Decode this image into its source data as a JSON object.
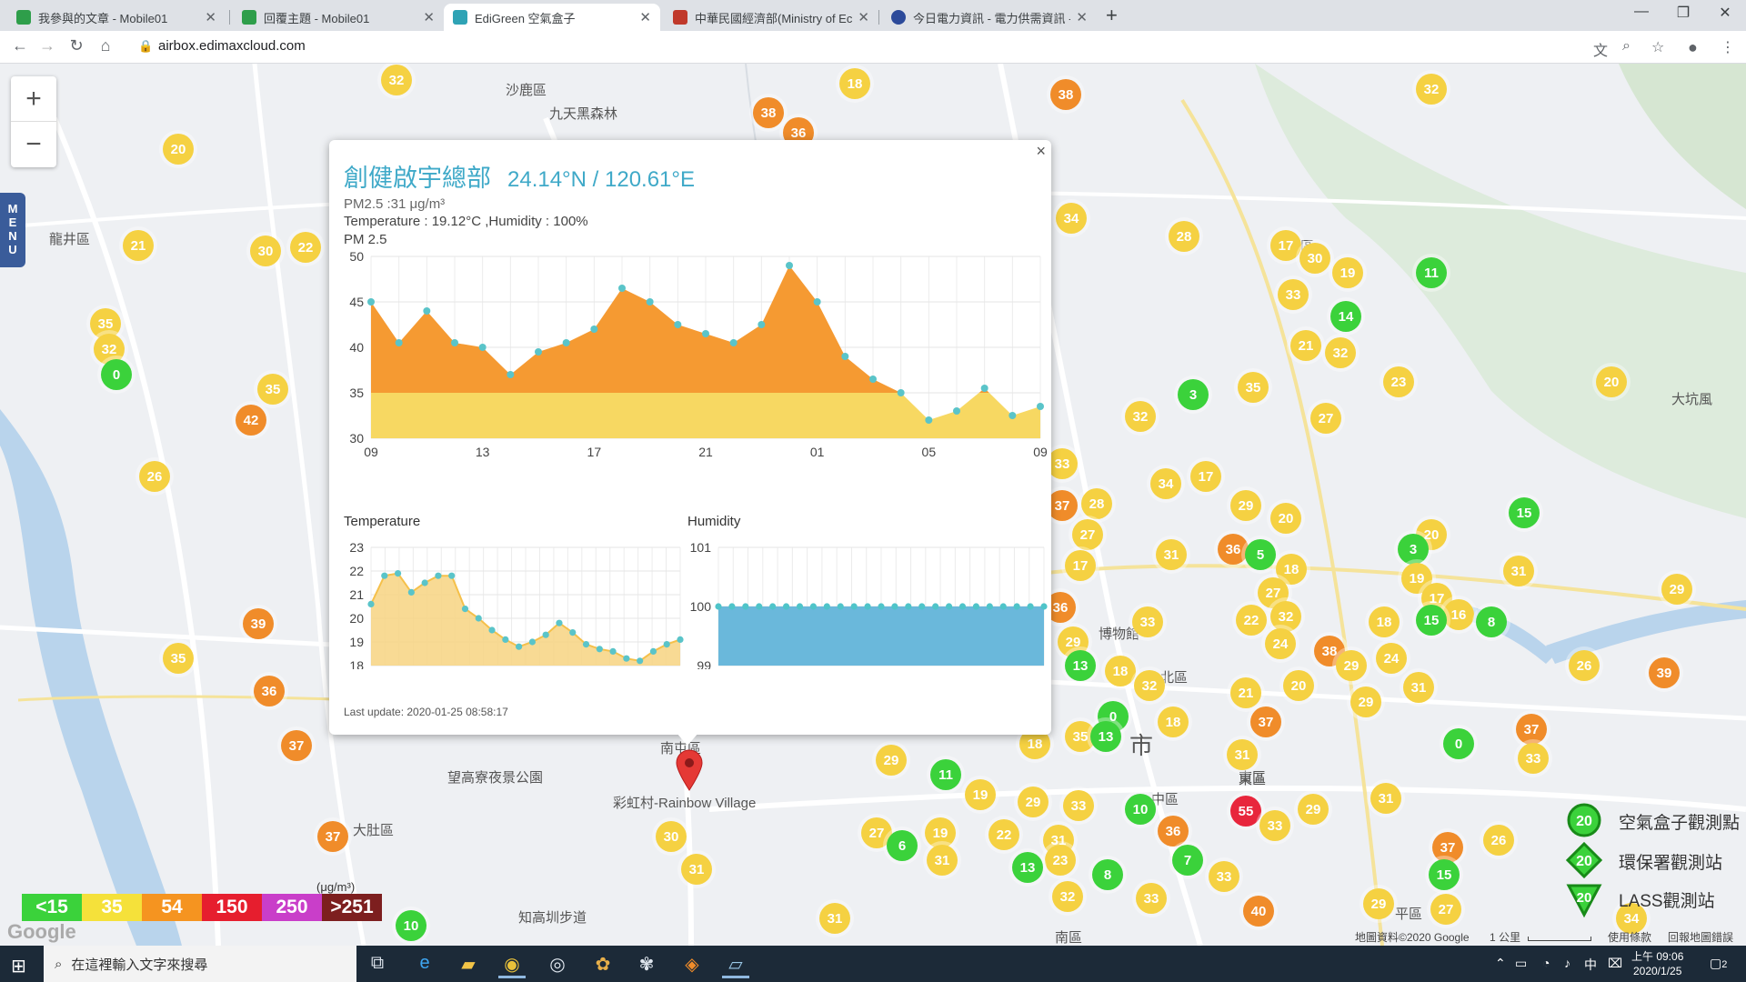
{
  "browser": {
    "tabs": [
      {
        "title": "我參與的文章 - Mobile01",
        "favicon_color": "#2e9e4a",
        "active": false
      },
      {
        "title": "回覆主題 - Mobile01",
        "favicon_color": "#2e9e4a",
        "active": false
      },
      {
        "title": "EdiGreen 空氣盒子",
        "favicon_color": "#2fa3b5",
        "active": true
      },
      {
        "title": "中華民國經濟部(Ministry of Eco",
        "favicon_color": "#c0392b",
        "active": false
      },
      {
        "title": "今日電力資訊 - 電力供需資訊 - 決",
        "favicon_color": "#2c4a9a",
        "active": false
      }
    ],
    "url": "airbox.edimaxcloud.com"
  },
  "map": {
    "labels": [
      {
        "text": "沙鹿區"
      },
      {
        "text": "九天黑森林"
      },
      {
        "text": "龍井區"
      },
      {
        "text": "潭子區"
      },
      {
        "text": "大坑風"
      },
      {
        "text": "望高寮夜景公園"
      },
      {
        "text": "彩虹村-Rainbow Village"
      },
      {
        "text": "大肚區"
      },
      {
        "text": "知高圳步道"
      },
      {
        "text": "北區"
      },
      {
        "text": "中區"
      },
      {
        "text": "東區"
      },
      {
        "text": "南屯區"
      },
      {
        "text": "南區"
      },
      {
        "text": "市"
      },
      {
        "text": "平區"
      },
      {
        "text": "東區"
      },
      {
        "text": "博物館"
      }
    ],
    "markers": [
      {
        "v": 32,
        "c": "#f5d142",
        "x": 436,
        "y": 18
      },
      {
        "v": 18,
        "c": "#f5d142",
        "x": 940,
        "y": 22
      },
      {
        "v": 38,
        "c": "#f08c2a",
        "x": 845,
        "y": 54
      },
      {
        "v": 36,
        "c": "#f08c2a",
        "x": 878,
        "y": 76
      },
      {
        "v": 38,
        "c": "#f08c2a",
        "x": 1172,
        "y": 34
      },
      {
        "v": 32,
        "c": "#f5d142",
        "x": 1574,
        "y": 28
      },
      {
        "v": 20,
        "c": "#f5d142",
        "x": 196,
        "y": 94
      },
      {
        "v": 21,
        "c": "#f5d142",
        "x": 152,
        "y": 200
      },
      {
        "v": 30,
        "c": "#f5d142",
        "x": 292,
        "y": 206
      },
      {
        "v": 22,
        "c": "#f5d142",
        "x": 336,
        "y": 202
      },
      {
        "v": 34,
        "c": "#f5d142",
        "x": 1178,
        "y": 170
      },
      {
        "v": 28,
        "c": "#f5d142",
        "x": 1302,
        "y": 190
      },
      {
        "v": 17,
        "c": "#f5d142",
        "x": 1414,
        "y": 200
      },
      {
        "v": 30,
        "c": "#f5d142",
        "x": 1446,
        "y": 214
      },
      {
        "v": 19,
        "c": "#f5d142",
        "x": 1482,
        "y": 230
      },
      {
        "v": 11,
        "c": "#3bd23b",
        "x": 1574,
        "y": 230
      },
      {
        "v": 33,
        "c": "#f5d142",
        "x": 1422,
        "y": 254
      },
      {
        "v": 14,
        "c": "#3bd23b",
        "x": 1480,
        "y": 278
      },
      {
        "v": 35,
        "c": "#f5d142",
        "x": 116,
        "y": 286
      },
      {
        "v": 32,
        "c": "#f5d142",
        "x": 120,
        "y": 314
      },
      {
        "v": 0,
        "c": "#3bd23b",
        "x": 128,
        "y": 342
      },
      {
        "v": 35,
        "c": "#f5d142",
        "x": 300,
        "y": 358
      },
      {
        "v": 42,
        "c": "#f08c2a",
        "x": 276,
        "y": 392
      },
      {
        "v": 21,
        "c": "#f5d142",
        "x": 1436,
        "y": 310
      },
      {
        "v": 32,
        "c": "#f5d142",
        "x": 1474,
        "y": 318
      },
      {
        "v": 23,
        "c": "#f5d142",
        "x": 1538,
        "y": 350
      },
      {
        "v": 20,
        "c": "#f5d142",
        "x": 1772,
        "y": 350
      },
      {
        "v": 3,
        "c": "#3bd23b",
        "x": 1312,
        "y": 364
      },
      {
        "v": 35,
        "c": "#f5d142",
        "x": 1378,
        "y": 356
      },
      {
        "v": 32,
        "c": "#f5d142",
        "x": 1254,
        "y": 388
      },
      {
        "v": 27,
        "c": "#f5d142",
        "x": 1458,
        "y": 390
      },
      {
        "v": 26,
        "c": "#f5d142",
        "x": 170,
        "y": 454
      },
      {
        "v": 33,
        "c": "#f5d142",
        "x": 1168,
        "y": 440
      },
      {
        "v": 34,
        "c": "#f5d142",
        "x": 1282,
        "y": 462
      },
      {
        "v": 17,
        "c": "#f5d142",
        "x": 1326,
        "y": 454
      },
      {
        "v": 29,
        "c": "#f5d142",
        "x": 1370,
        "y": 486
      },
      {
        "v": 20,
        "c": "#f5d142",
        "x": 1414,
        "y": 500
      },
      {
        "v": 37,
        "c": "#f08c2a",
        "x": 1168,
        "y": 486
      },
      {
        "v": 28,
        "c": "#f5d142",
        "x": 1206,
        "y": 484
      },
      {
        "v": 27,
        "c": "#f5d142",
        "x": 1196,
        "y": 518
      },
      {
        "v": 15,
        "c": "#3bd23b",
        "x": 1676,
        "y": 494
      },
      {
        "v": 20,
        "c": "#f5d142",
        "x": 1574,
        "y": 518
      },
      {
        "v": 3,
        "c": "#3bd23b",
        "x": 1554,
        "y": 534
      },
      {
        "v": 31,
        "c": "#f5d142",
        "x": 1288,
        "y": 540
      },
      {
        "v": 36,
        "c": "#f08c2a",
        "x": 1356,
        "y": 534
      },
      {
        "v": 5,
        "c": "#3bd23b",
        "x": 1386,
        "y": 540
      },
      {
        "v": 18,
        "c": "#f5d142",
        "x": 1420,
        "y": 556
      },
      {
        "v": 17,
        "c": "#f5d142",
        "x": 1188,
        "y": 552
      },
      {
        "v": 31,
        "c": "#f5d142",
        "x": 1670,
        "y": 558
      },
      {
        "v": 29,
        "c": "#f5d142",
        "x": 1844,
        "y": 578
      },
      {
        "v": 19,
        "c": "#f5d142",
        "x": 1558,
        "y": 566
      },
      {
        "v": 27,
        "c": "#f5d142",
        "x": 1400,
        "y": 582
      },
      {
        "v": 17,
        "c": "#f5d142",
        "x": 1580,
        "y": 588
      },
      {
        "v": 36,
        "c": "#f08c2a",
        "x": 1166,
        "y": 598
      },
      {
        "v": 22,
        "c": "#f5d142",
        "x": 1376,
        "y": 612
      },
      {
        "v": 32,
        "c": "#f5d142",
        "x": 1414,
        "y": 608
      },
      {
        "v": 33,
        "c": "#f5d142",
        "x": 1262,
        "y": 614
      },
      {
        "v": 16,
        "c": "#f5d142",
        "x": 1604,
        "y": 606
      },
      {
        "v": 15,
        "c": "#3bd23b",
        "x": 1574,
        "y": 612
      },
      {
        "v": 8,
        "c": "#3bd23b",
        "x": 1640,
        "y": 614
      },
      {
        "v": 18,
        "c": "#f5d142",
        "x": 1522,
        "y": 614
      },
      {
        "v": 24,
        "c": "#f5d142",
        "x": 1408,
        "y": 638
      },
      {
        "v": 39,
        "c": "#f08c2a",
        "x": 284,
        "y": 616
      },
      {
        "v": 29,
        "c": "#f5d142",
        "x": 1180,
        "y": 636
      },
      {
        "v": 38,
        "c": "#f08c2a",
        "x": 1462,
        "y": 646
      },
      {
        "v": 29,
        "c": "#f5d142",
        "x": 1486,
        "y": 662
      },
      {
        "v": 24,
        "c": "#f5d142",
        "x": 1530,
        "y": 654
      },
      {
        "v": 35,
        "c": "#f5d142",
        "x": 196,
        "y": 654
      },
      {
        "v": 13,
        "c": "#3bd23b",
        "x": 1188,
        "y": 662
      },
      {
        "v": 18,
        "c": "#f5d142",
        "x": 1232,
        "y": 668
      },
      {
        "v": 26,
        "c": "#f5d142",
        "x": 1742,
        "y": 662
      },
      {
        "v": 39,
        "c": "#f08c2a",
        "x": 1830,
        "y": 670
      },
      {
        "v": 36,
        "c": "#f08c2a",
        "x": 296,
        "y": 690
      },
      {
        "v": 32,
        "c": "#f5d142",
        "x": 1264,
        "y": 684
      },
      {
        "v": 21,
        "c": "#f5d142",
        "x": 1370,
        "y": 692
      },
      {
        "v": 20,
        "c": "#f5d142",
        "x": 1428,
        "y": 684
      },
      {
        "v": 29,
        "c": "#f5d142",
        "x": 1502,
        "y": 702
      },
      {
        "v": 31,
        "c": "#f5d142",
        "x": 1560,
        "y": 686
      },
      {
        "v": 0,
        "c": "#3bd23b",
        "x": 1224,
        "y": 718
      },
      {
        "v": 18,
        "c": "#f5d142",
        "x": 1290,
        "y": 724
      },
      {
        "v": 37,
        "c": "#f08c2a",
        "x": 1392,
        "y": 724
      },
      {
        "v": 37,
        "c": "#f08c2a",
        "x": 1684,
        "y": 732
      },
      {
        "v": 37,
        "c": "#f08c2a",
        "x": 326,
        "y": 750
      },
      {
        "v": 35,
        "c": "#f5d142",
        "x": 1188,
        "y": 740
      },
      {
        "v": 13,
        "c": "#3bd23b",
        "x": 1216,
        "y": 740
      },
      {
        "v": 0,
        "c": "#3bd23b",
        "x": 1604,
        "y": 748
      },
      {
        "v": 33,
        "c": "#f5d142",
        "x": 1686,
        "y": 764
      },
      {
        "v": 18,
        "c": "#f5d142",
        "x": 1138,
        "y": 748
      },
      {
        "v": 31,
        "c": "#f5d142",
        "x": 1366,
        "y": 760
      },
      {
        "v": 29,
        "c": "#f5d142",
        "x": 980,
        "y": 766
      },
      {
        "v": 11,
        "c": "#3bd23b",
        "x": 1040,
        "y": 782
      },
      {
        "v": 19,
        "c": "#f5d142",
        "x": 1078,
        "y": 804
      },
      {
        "v": 29,
        "c": "#f5d142",
        "x": 1136,
        "y": 812
      },
      {
        "v": 33,
        "c": "#f5d142",
        "x": 1186,
        "y": 816
      },
      {
        "v": 10,
        "c": "#3bd23b",
        "x": 1254,
        "y": 820
      },
      {
        "v": 31,
        "c": "#f5d142",
        "x": 1524,
        "y": 808
      },
      {
        "v": 55,
        "c": "#e8263c",
        "x": 1370,
        "y": 822
      },
      {
        "v": 33,
        "c": "#f5d142",
        "x": 1402,
        "y": 838
      },
      {
        "v": 29,
        "c": "#f5d142",
        "x": 1444,
        "y": 820
      },
      {
        "v": 30,
        "c": "#f5d142",
        "x": 738,
        "y": 850
      },
      {
        "v": 27,
        "c": "#f5d142",
        "x": 964,
        "y": 846
      },
      {
        "v": 19,
        "c": "#f5d142",
        "x": 1034,
        "y": 846
      },
      {
        "v": 22,
        "c": "#f5d142",
        "x": 1104,
        "y": 848
      },
      {
        "v": 31,
        "c": "#f5d142",
        "x": 1164,
        "y": 854
      },
      {
        "v": 36,
        "c": "#f08c2a",
        "x": 1290,
        "y": 844
      },
      {
        "v": 26,
        "c": "#f5d142",
        "x": 1648,
        "y": 854
      },
      {
        "v": 37,
        "c": "#f08c2a",
        "x": 1592,
        "y": 862
      },
      {
        "v": 37,
        "c": "#f08c2a",
        "x": 366,
        "y": 850
      },
      {
        "v": 6,
        "c": "#3bd23b",
        "x": 992,
        "y": 860
      },
      {
        "v": 31,
        "c": "#f5d142",
        "x": 1036,
        "y": 876
      },
      {
        "v": 23,
        "c": "#f5d142",
        "x": 1166,
        "y": 876
      },
      {
        "v": 13,
        "c": "#3bd23b",
        "x": 1130,
        "y": 884
      },
      {
        "v": 7,
        "c": "#3bd23b",
        "x": 1306,
        "y": 876
      },
      {
        "v": 33,
        "c": "#f5d142",
        "x": 1346,
        "y": 894
      },
      {
        "v": 8,
        "c": "#3bd23b",
        "x": 1218,
        "y": 892
      },
      {
        "v": 15,
        "c": "#3bd23b",
        "x": 1588,
        "y": 892
      },
      {
        "v": 31,
        "c": "#f5d142",
        "x": 766,
        "y": 886
      },
      {
        "v": 32,
        "c": "#f5d142",
        "x": 1174,
        "y": 916
      },
      {
        "v": 33,
        "c": "#f5d142",
        "x": 1266,
        "y": 918
      },
      {
        "v": 40,
        "c": "#f08c2a",
        "x": 1384,
        "y": 932
      },
      {
        "v": 29,
        "c": "#f5d142",
        "x": 1516,
        "y": 924
      },
      {
        "v": 27,
        "c": "#f5d142",
        "x": 1590,
        "y": 930
      },
      {
        "v": 31,
        "c": "#f5d142",
        "x": 918,
        "y": 940
      },
      {
        "v": 10,
        "c": "#3bd23b",
        "x": 452,
        "y": 948
      },
      {
        "v": 34,
        "c": "#f5d142",
        "x": 1794,
        "y": 940
      }
    ],
    "zoom_in": "+",
    "zoom_out": "−",
    "menu_label": "MENU",
    "scale_legend": [
      {
        "label": "<15",
        "color": "#3bd23b"
      },
      {
        "label": "35",
        "color": "#f5e13a"
      },
      {
        "label": "54",
        "color": "#f59420"
      },
      {
        "label": "150",
        "color": "#e61e2e"
      },
      {
        "label": "250",
        "color": "#c93ec9"
      },
      {
        "label": ">251",
        "color": "#7d1f1f"
      }
    ],
    "unit": "(μg/m³)",
    "google_logo": "Google",
    "right_legend": [
      {
        "num": "20",
        "text": "空氣盒子觀測點",
        "shape": "circle"
      },
      {
        "num": "20",
        "text": "環保署觀測站",
        "shape": "diamond"
      },
      {
        "num": "20",
        "text": "LASS觀測站",
        "shape": "triangle"
      }
    ],
    "attribution": {
      "data": "地圖資料©2020 Google",
      "scale": "1 公里",
      "terms": "使用條款",
      "report": "回報地圖錯誤"
    }
  },
  "popup": {
    "title": "創健啟宇總部",
    "coords": "24.14°N / 120.61°E",
    "pm_line": "PM2.5 :31 μg/m³",
    "temp_line": "Temperature : 19.12°C ,Humidity : 100%",
    "pm_label": "PM 2.5",
    "temp_label": "Temperature",
    "hum_label": "Humidity",
    "last_update": "Last update: 2020-01-25 08:58:17",
    "close": "×"
  },
  "chart_data": [
    {
      "type": "area",
      "title": "PM 2.5",
      "x_ticks": [
        "09",
        "13",
        "17",
        "21",
        "01",
        "05",
        "09"
      ],
      "ylim": [
        30,
        50
      ],
      "y_ticks": [
        30,
        35,
        40,
        45,
        50
      ],
      "values": [
        45,
        40.5,
        44,
        40.5,
        40,
        37,
        39.5,
        40.5,
        42,
        46.5,
        45,
        42.5,
        41.5,
        40.5,
        42.5,
        49,
        45,
        39,
        36.5,
        35,
        32,
        33,
        35.5,
        32.5,
        33.5
      ],
      "threshold": 35,
      "colors": {
        "above": "#f59a32",
        "below": "#f7d862",
        "point": "#5ac4c9"
      }
    },
    {
      "type": "area",
      "title": "Temperature",
      "ylim": [
        18,
        23
      ],
      "y_ticks": [
        18,
        19,
        20,
        21,
        22,
        23
      ],
      "values": [
        20.6,
        21.8,
        21.9,
        21.1,
        21.5,
        21.8,
        21.8,
        20.4,
        20,
        19.5,
        19.1,
        18.8,
        19,
        19.3,
        19.8,
        19.4,
        18.9,
        18.7,
        18.6,
        18.3,
        18.2,
        18.6,
        18.9,
        19.1
      ],
      "colors": {
        "fill": "#f7d481",
        "line": "#f5c04a",
        "point": "#5ac4c9"
      }
    },
    {
      "type": "area",
      "title": "Humidity",
      "ylim": [
        99,
        101
      ],
      "y_ticks": [
        99,
        100,
        101
      ],
      "values": [
        100,
        100,
        100,
        100,
        100,
        100,
        100,
        100,
        100,
        100,
        100,
        100,
        100,
        100,
        100,
        100,
        100,
        100,
        100,
        100,
        100,
        100,
        100,
        100,
        100
      ],
      "colors": {
        "fill": "#6ab8db",
        "point": "#4fc4c9"
      }
    }
  ],
  "taskbar": {
    "search_placeholder": "在這裡輸入文字來搜尋",
    "time": "上午 09:06",
    "date": "2020/1/25",
    "ime": "中",
    "notif_count": "2"
  }
}
